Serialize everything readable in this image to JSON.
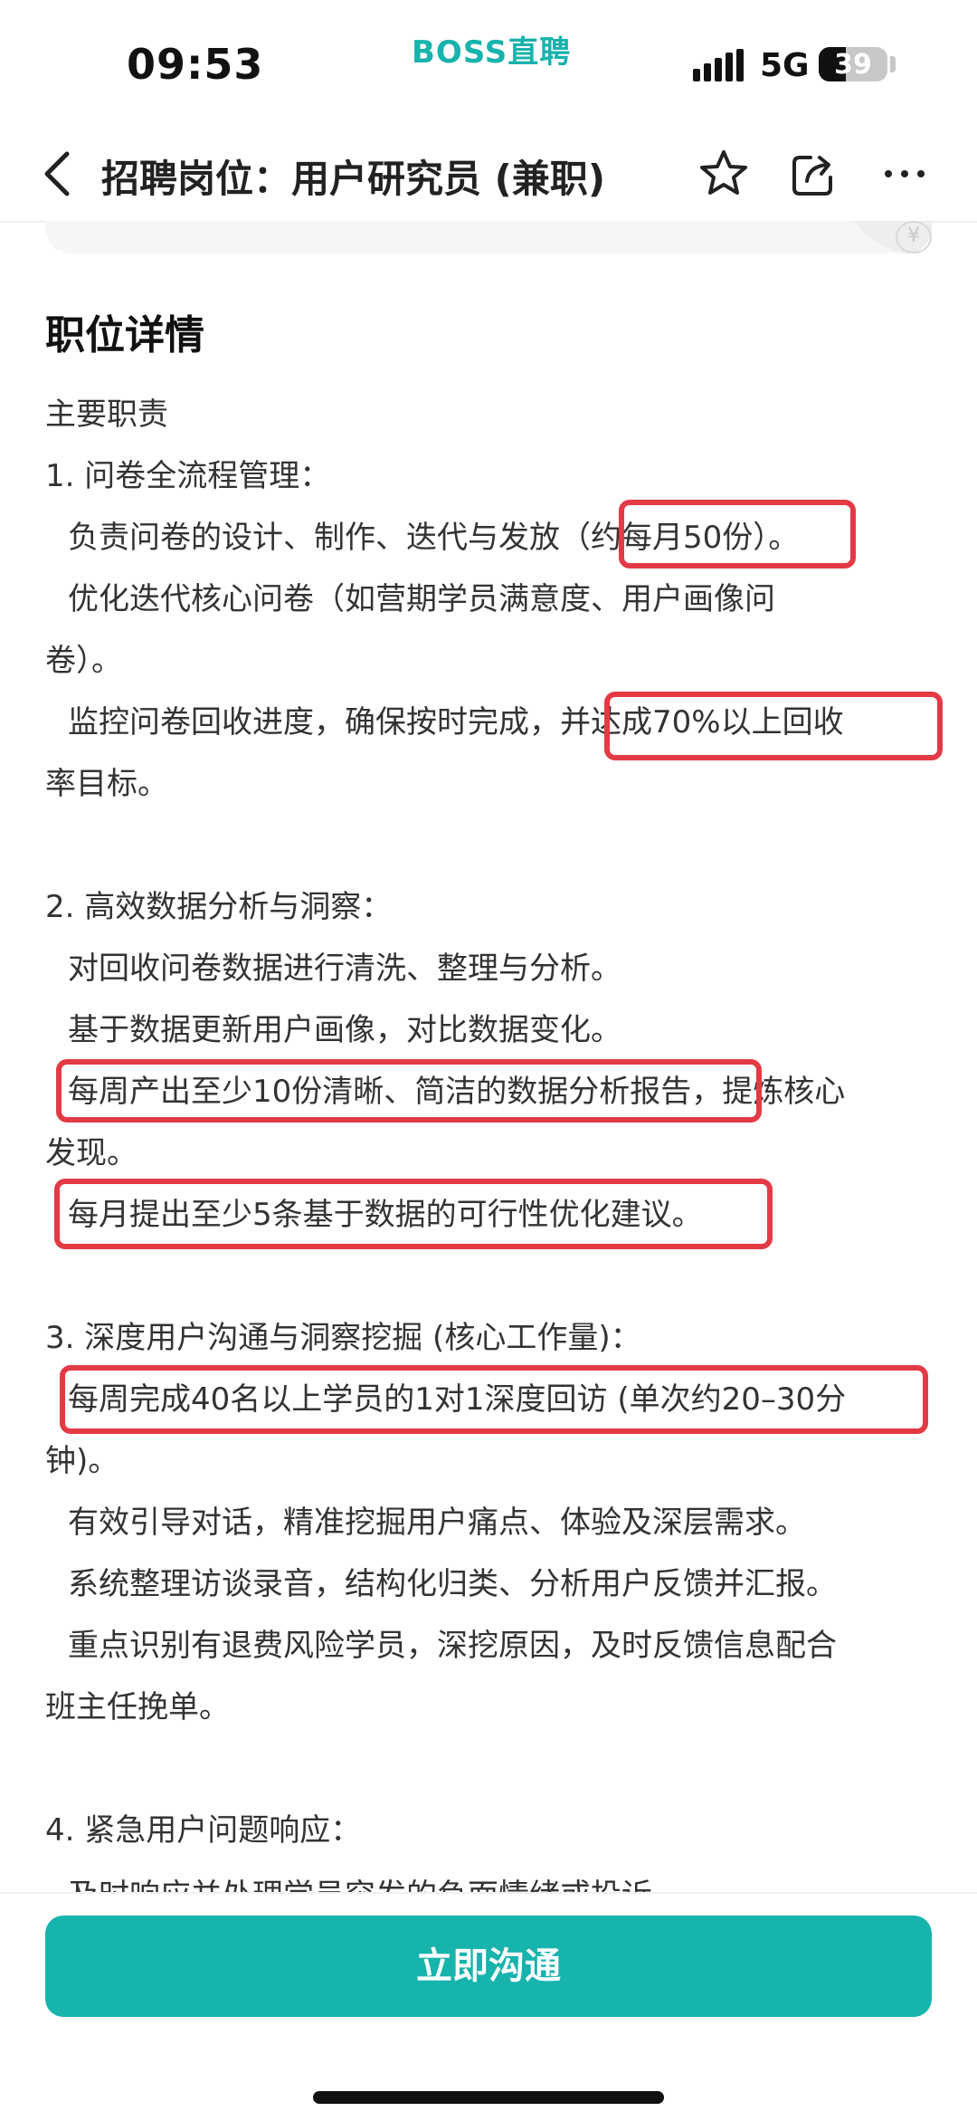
{
  "status_bar": {
    "time": "09:53",
    "brand": "BOSS直聘",
    "network": "5G",
    "battery": "39",
    "battery_level": 0.39
  },
  "header": {
    "title": "招聘岗位：用户研究员 (兼职)",
    "icons": [
      "back-icon",
      "star-icon",
      "share-icon",
      "more-icon"
    ]
  },
  "section": {
    "title": "职位详情",
    "lines": [
      "主要职责",
      "1. 问卷全流程管理：",
      "负责问卷的设计、制作、迭代与发放（约每月50份）。",
      "优化迭代核心问卷（如营期学员满意度、用户画像问",
      "卷）。",
      "监控问卷回收进度，确保按时完成，并达成70%以上回收",
      "率目标。",
      "2. 高效数据分析与洞察：",
      "对回收问卷数据进行清洗、整理与分析。",
      "基于数据更新用户画像，对比数据变化。",
      "每周产出至少10份清晰、简洁的数据分析报告，提炼核心",
      "发现。",
      "每月提出至少5条基于数据的可行性优化建议。",
      "3. 深度用户沟通与洞察挖掘 (核心工作量)：",
      "每周完成40名以上学员的1对1深度回访 (单次约20–30分",
      "钟)。",
      "有效引导对话，精准挖掘用户痛点、体验及深层需求。",
      "系统整理访谈录音，结构化归类、分析用户反馈并汇报。",
      "重点识别有退费风险学员，深挖原因，及时反馈信息配合",
      "班主任挽单。",
      "4. 紧急用户问题响应：",
      "及时响应并处理学员突发的负面情绪或投诉。"
    ]
  },
  "cta": {
    "label": "立即沟通"
  },
  "colors": {
    "brand": "#17b3ad",
    "highlight": "#e33a46"
  }
}
